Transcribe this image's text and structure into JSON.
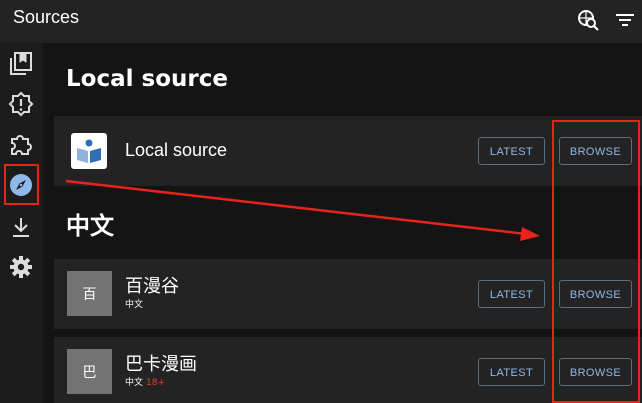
{
  "header": {
    "title": "Sources"
  },
  "sidebar": {
    "items": [
      {
        "name": "library",
        "icon": "library-icon"
      },
      {
        "name": "updates",
        "icon": "alert-badge-icon"
      },
      {
        "name": "extensions",
        "icon": "puzzle-icon"
      },
      {
        "name": "sources",
        "icon": "compass-icon",
        "active": true
      },
      {
        "name": "downloads",
        "icon": "download-icon"
      },
      {
        "name": "settings",
        "icon": "gear-icon"
      }
    ]
  },
  "sections": {
    "local": {
      "title": "Local source"
    },
    "chinese": {
      "title": "中文"
    }
  },
  "sources": [
    {
      "name": "Local source",
      "thumb_text": "",
      "lang": "",
      "nsfw": ""
    },
    {
      "name": "百漫谷",
      "thumb_text": "百",
      "lang": "中文",
      "nsfw": ""
    },
    {
      "name": "巴卡漫画",
      "thumb_text": "巴",
      "lang": "中文",
      "nsfw": "18+"
    }
  ],
  "buttons": {
    "latest": "LATEST",
    "browse": "BROWSE"
  },
  "colors": {
    "annotation": "#e8231c",
    "button_text": "#8fb9e8",
    "active_nav": "#8fb9e8"
  }
}
